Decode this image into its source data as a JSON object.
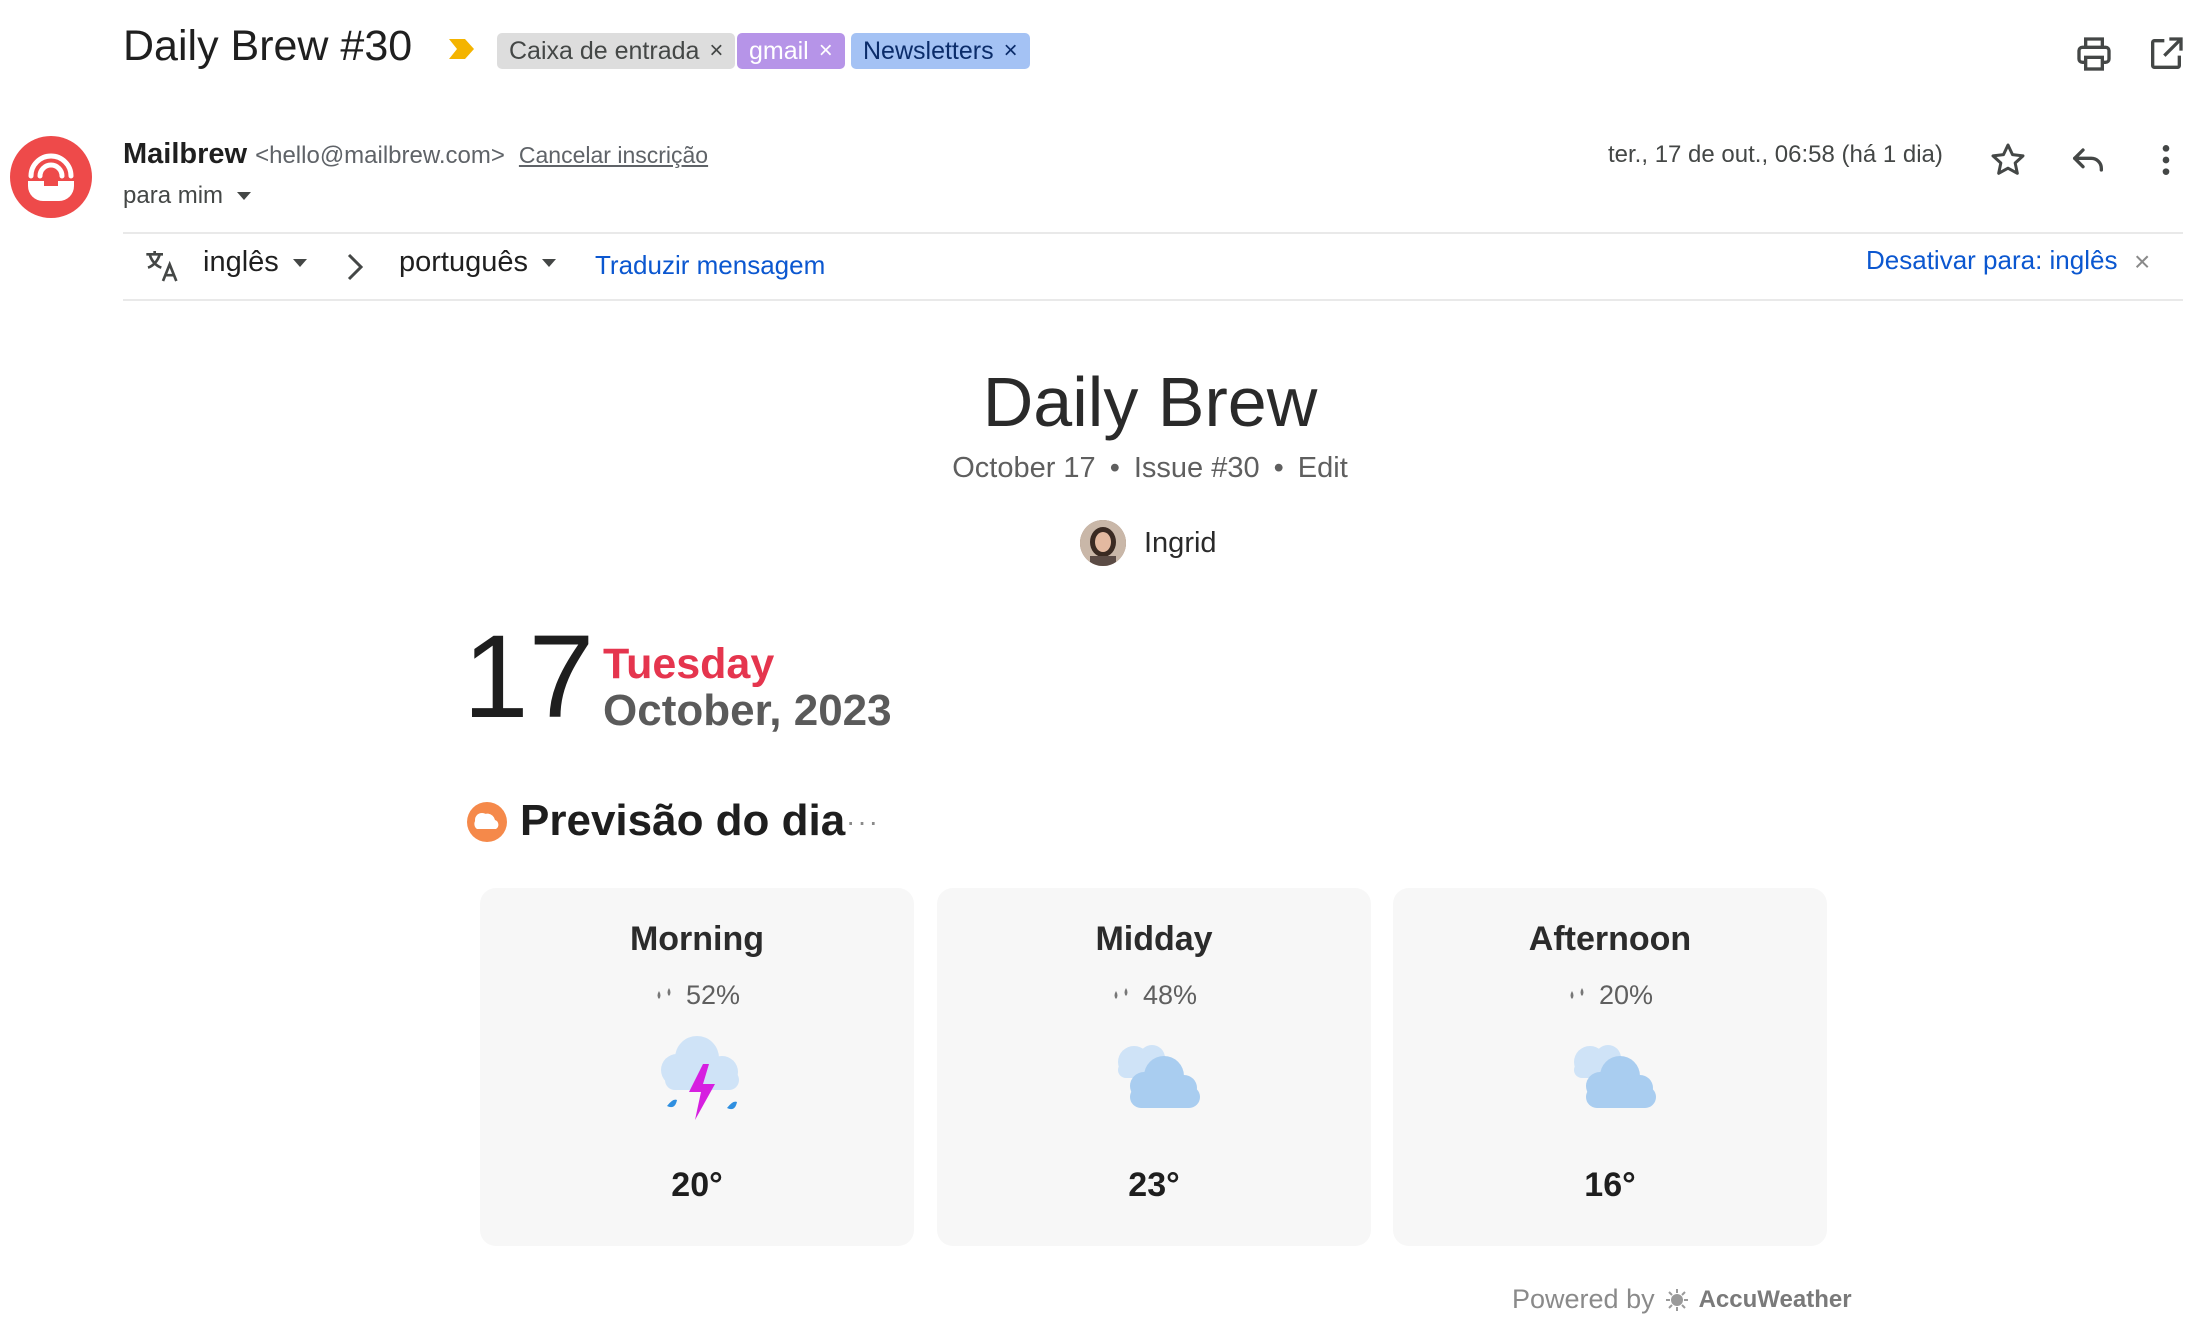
{
  "email": {
    "subject": "Daily Brew #30",
    "labels": [
      {
        "name": "Caixa de entrada",
        "remove": "×"
      },
      {
        "name": "gmail",
        "remove": "×"
      },
      {
        "name": "Newsletters",
        "remove": "×"
      }
    ],
    "sender_name": "Mailbrew",
    "sender_email": "<hello@mailbrew.com>",
    "unsubscribe": "Cancelar inscrição",
    "to": "para mim",
    "date": "ter., 17 de out., 06:58 (há 1 dia)"
  },
  "translate": {
    "from_lang": "inglês",
    "to_lang": "português",
    "translate_link": "Traduzir mensagem",
    "disable_link": "Desativar para: inglês",
    "close": "×"
  },
  "newsletter": {
    "title": "Daily Brew",
    "date": "October 17",
    "issue": "Issue #30",
    "edit": "Edit",
    "dot": "•",
    "author": "Ingrid",
    "day_number": "17",
    "weekday": "Tuesday",
    "month_year": "October, 2023"
  },
  "forecast": {
    "title": "Previsão do dia",
    "more": "···",
    "periods": [
      {
        "name": "Morning",
        "precip": "52%",
        "temp": "20°",
        "icon": "thunderstorm-rain-icon"
      },
      {
        "name": "Midday",
        "precip": "48%",
        "temp": "23°",
        "icon": "cloudy-icon"
      },
      {
        "name": "Afternoon",
        "precip": "20%",
        "temp": "16°",
        "icon": "cloudy-icon"
      }
    ],
    "powered_by": "Powered by",
    "provider": "AccuWeather"
  },
  "colors": {
    "accent_red": "#e5354e",
    "logo_red": "#ee4a4a",
    "link_blue": "#0b57d0",
    "chip_gmail": "#b694e8",
    "chip_newsletters": "#a4c2f4"
  }
}
